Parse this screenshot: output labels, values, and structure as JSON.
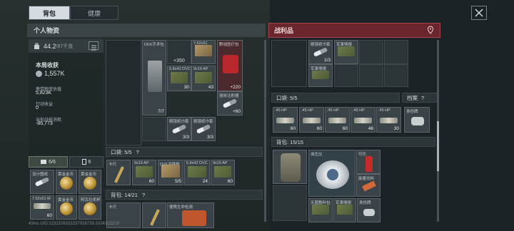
{
  "tabs": [
    {
      "label": "背包"
    },
    {
      "label": "健康"
    }
  ],
  "left_header": {
    "title": "个人物资"
  },
  "right_header": {
    "title": "战利品"
  },
  "stats": {
    "weight": "44.2",
    "weight_unit": "/87千克",
    "income_label": "本局收获",
    "income_value": "1,557K",
    "carry_label": "携带物资估值",
    "carry_value": "5,823K",
    "action_label": "行动收益",
    "action_value": "0",
    "loss_label": "当前战损消耗",
    "loss_value": "-86,773"
  },
  "container_tabs": [
    {
      "label": "6/6"
    },
    {
      "label": "6"
    }
  ],
  "left_sections": {
    "pocket": "口袋: 5/5",
    "backpack": "背包: 14/21"
  },
  "right_sections": {
    "pocket": "口袋: 5/5",
    "archive": "档案",
    "backpack": "背包: 15/15"
  },
  "help_mark": "?",
  "left_grid_items": [
    {
      "name": "DEK手术包",
      "count": "7/7"
    },
    {
      "name": "7.62x51",
      "count": "350",
      "prefix": "+"
    },
    {
      "name": "野战医疗包",
      "count": "220",
      "prefix": "+"
    },
    {
      "name": "5.8x42 DVC",
      "count": "30"
    },
    {
      "name": "9x19 AP",
      "count": "43"
    },
    {
      "name": "强效注射器",
      "count": "60",
      "prefix": "+"
    },
    {
      "name": "眼镜纸巾套",
      "count": "3/3"
    },
    {
      "name": "眼镜纸巾套",
      "count": "3/3"
    }
  ],
  "left_pocket_items": [
    {
      "name": "卡尺",
      "count": ""
    },
    {
      "name": "9x19 AP",
      "count": "60"
    },
    {
      "name": "DVE冲锋枪",
      "count": "5/5"
    },
    {
      "name": "5.8x42 DVC",
      "count": "24"
    },
    {
      "name": "9x19 AP",
      "count": "60"
    }
  ],
  "left_special_items": [
    {
      "name": "设计图纸",
      "count": ""
    },
    {
      "name": "黄金金币",
      "count": ""
    },
    {
      "name": "黄金金币",
      "count": ""
    },
    {
      "name": "7.62x51 M",
      "count": "60"
    },
    {
      "name": "黄金金币",
      "count": ""
    },
    {
      "name": "阿瓦拉奖杯",
      "count": ""
    }
  ],
  "left_backpack_items": [
    {
      "name": "卡尺"
    },
    {
      "name": "便携生命检测"
    }
  ],
  "right_top_items": [
    {
      "name": "眼镜纸巾套",
      "count": "1/3"
    },
    {
      "name": "军事情报",
      "count": ""
    },
    {
      "name": "军事情报",
      "count": ""
    }
  ],
  "right_pocket_items": [
    {
      "name": ".45 HP",
      "count": "60"
    },
    {
      "name": ".45 HP",
      "count": "60"
    },
    {
      "name": ".45 HP",
      "count": "60"
    },
    {
      "name": ".45 HP",
      "count": "48"
    },
    {
      "name": ".45 HP",
      "count": "30"
    }
  ],
  "right_archive_item": {
    "name": "身份牌"
  },
  "right_backpack_items": [
    {
      "name": ""
    },
    {
      "name": "血压仪"
    },
    {
      "name": "可乐"
    },
    {
      "name": "能量饮料"
    },
    {
      "name": "无菌敷料包"
    },
    {
      "name": "军事情报"
    },
    {
      "name": "身份牌"
    }
  ],
  "footer": {
    "text": "43ms  UID:1232108102237016729.2024122219"
  },
  "colors": {
    "accent_red": "#6a262c",
    "panel": "#2b3437",
    "tab_active": "#d5dbe0"
  }
}
